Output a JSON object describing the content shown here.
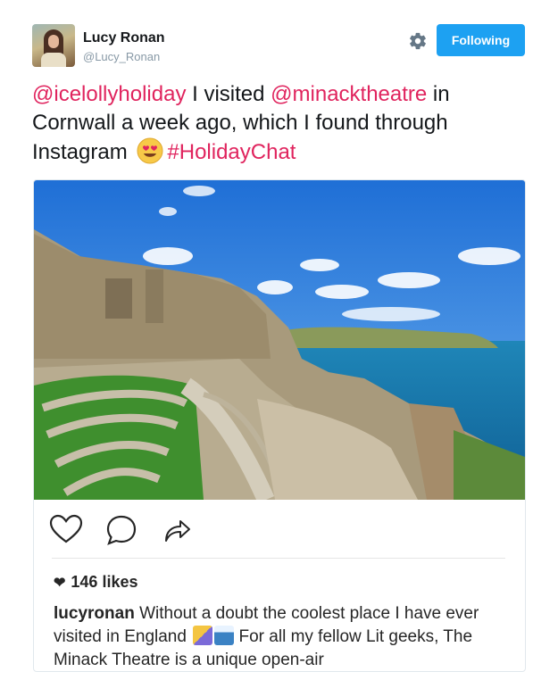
{
  "author": {
    "name": "Lucy Ronan",
    "handle": "@Lucy_Ronan"
  },
  "follow_button": {
    "label": "Following"
  },
  "icons": {
    "settings": "gear-icon",
    "like": "heart-outline-icon",
    "comment": "speech-bubble-icon",
    "share": "share-arrow-icon",
    "likes_heart": "heart-filled-icon",
    "emoji": "heart-eyes-emoji-icon"
  },
  "tweet": {
    "mention1": "@icelollyholiday",
    "text1": " I visited ",
    "mention2": "@minacktheatre",
    "text2": " in Cornwall a week ago, which I found through Instagram ",
    "hashtag": "#HolidayChat"
  },
  "post": {
    "likes_count": "146 likes",
    "caption_user": "lucyronan",
    "caption_text1": " Without a doubt the coolest place I have ever visited in England ",
    "caption_text2": " For all my fellow Lit geeks, The Minack Theatre is a unique open-air"
  },
  "colors": {
    "accent_blue": "#1da1f2",
    "mention_pink": "#e0245e",
    "text_dark": "#14171a",
    "text_gray": "#8899a6"
  }
}
